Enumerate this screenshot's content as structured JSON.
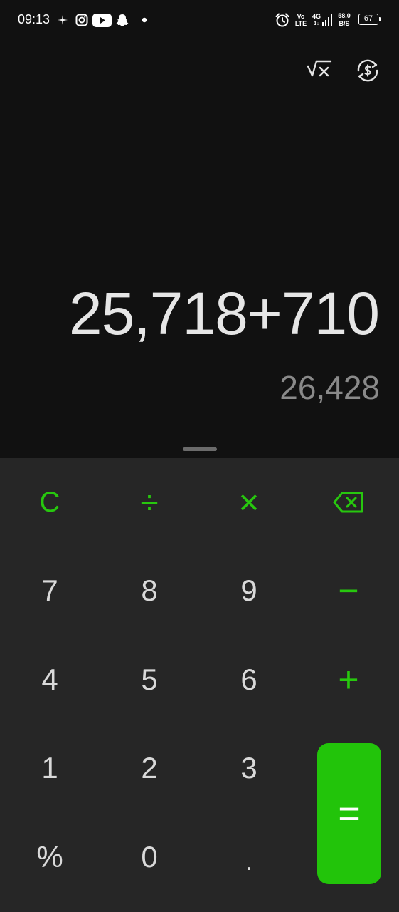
{
  "status_bar": {
    "time": "09:13",
    "volte_top": "Vo",
    "volte_bottom": "LTE",
    "network_type": "4G",
    "network_sub": "1↓",
    "speed_value": "58.0",
    "speed_unit": "B/S",
    "battery_level": "67"
  },
  "toolbar": {
    "scientific_icon": "sqrt-x-icon",
    "currency_icon": "currency-convert-icon"
  },
  "display": {
    "expression": "25,718+710",
    "result": "26,428"
  },
  "keypad": {
    "clear": "C",
    "divide": "÷",
    "multiply": "×",
    "backspace_icon": "backspace-icon",
    "seven": "7",
    "eight": "8",
    "nine": "9",
    "minus": "−",
    "four": "4",
    "five": "5",
    "six": "6",
    "plus": "+",
    "one": "1",
    "two": "2",
    "three": "3",
    "percent": "%",
    "zero": "0",
    "decimal": ".",
    "equals": "="
  },
  "colors": {
    "background": "#111111",
    "keypad_background": "#262626",
    "accent_green": "#27c70e",
    "equals_background": "#22c40a",
    "digit_text": "#d9d9d9",
    "result_text": "#8a8a8a"
  }
}
